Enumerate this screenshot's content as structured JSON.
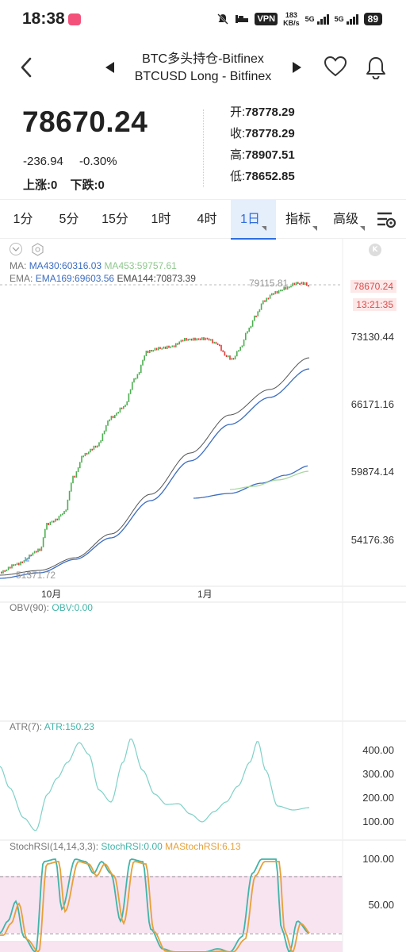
{
  "status_bar": {
    "time": "18:38",
    "vpn": "VPN",
    "net_speed_value": "183",
    "net_speed_unit": "KB/s",
    "network_1": "5G",
    "network_2": "5G",
    "battery": "89"
  },
  "header": {
    "title": "BTC多头持仓-Bitfinex",
    "subtitle": "BTCUSD Long - Bitfinex"
  },
  "quote": {
    "price": "78670.24",
    "change_abs": "-236.94",
    "change_pct": "-0.30%",
    "up_count": "上涨:0",
    "down_count": "下跌:0",
    "open_label": "开:",
    "open": "78778.29",
    "close_label": "收:",
    "close": "78778.29",
    "high_label": "高:",
    "high": "78907.51",
    "low_label": "低:",
    "low": "78652.85"
  },
  "tabs": [
    {
      "label": "1分"
    },
    {
      "label": "5分"
    },
    {
      "label": "15分"
    },
    {
      "label": "1时"
    },
    {
      "label": "4时"
    },
    {
      "label": "1日",
      "active": true
    },
    {
      "label": "指标"
    },
    {
      "label": "高级"
    }
  ],
  "main_chart": {
    "ma_label": "MA:",
    "ma430": "MA430:60316.03",
    "ma453": "MA453:59757.61",
    "ema_label": "EMA:",
    "ema169": "EMA169:69603.56",
    "ema144": "EMA144:70873.39",
    "high_marker": "79115.81",
    "low_marker": "51371.72",
    "current_price_tag": "78670.24",
    "countdown_tag": "13:21:35",
    "y_ticks": [
      "73130.44",
      "66171.16",
      "59874.14",
      "54176.36"
    ],
    "x_ticks": [
      "10月",
      "1月"
    ]
  },
  "obv_panel": {
    "label": "OBV(90):",
    "value": "OBV:0.00"
  },
  "atr_panel": {
    "label": "ATR(7):",
    "value": "ATR:150.23",
    "y_ticks": [
      "400.00",
      "300.00",
      "200.00",
      "100.00"
    ]
  },
  "stochrsi_panel": {
    "label": "StochRSI(14,14,3,3):",
    "value": "StochRSI:0.00",
    "ma_value": "MAStochRSI:6.13",
    "y_ticks": [
      "100.00",
      "50.00"
    ]
  },
  "colors": {
    "up": "#4caf50",
    "down": "#e53935",
    "accent": "#2f6de0",
    "ema_dark": "#555555",
    "ema_blue": "#3c6dc1",
    "ma_green": "#a8d8a0",
    "atr_line": "#7fd1c7",
    "stoch_teal": "#42b4a8",
    "stoch_orange": "#e5a13a",
    "stoch_band": "#f8e3f1"
  },
  "icons": {
    "back": "chevron-left-icon",
    "prev": "triangle-left-icon",
    "next": "triangle-right-icon",
    "favorite": "heart-icon",
    "alert": "bell-icon",
    "settings": "chart-settings-icon"
  }
}
